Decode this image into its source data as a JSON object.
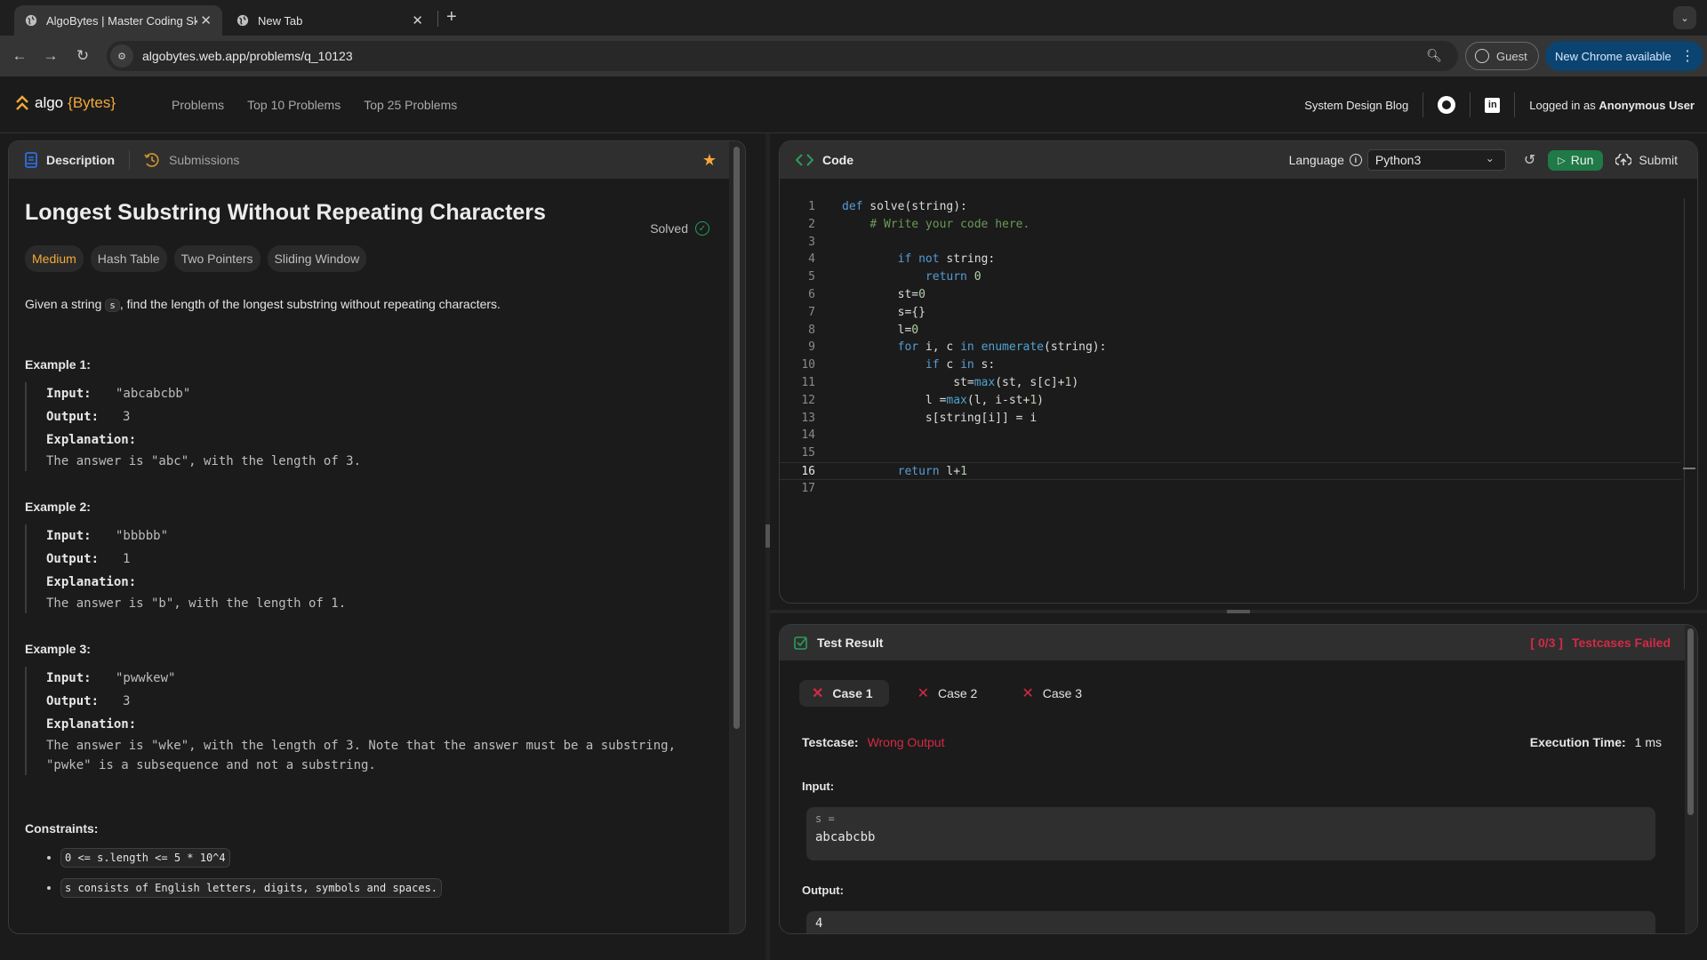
{
  "browser": {
    "tabs": [
      {
        "title": "AlgoBytes | Master Coding Sk",
        "active": true
      },
      {
        "title": "New Tab",
        "active": false
      }
    ],
    "url": "algobytes.web.app/problems/q_10123",
    "profile_label": "Guest",
    "update_label": "New Chrome available"
  },
  "app": {
    "logo_text": "algo",
    "logo_accent": "{Bytes}",
    "nav": [
      "Problems",
      "Top 10 Problems",
      "Top 25 Problems"
    ],
    "blog_link": "System Design Blog",
    "logged_in_prefix": "Logged in as ",
    "user_name": "Anonymous User",
    "accent_color": "#f2a93b"
  },
  "problem": {
    "tabs": {
      "description": "Description",
      "submissions": "Submissions"
    },
    "title": "Longest Substring Without Repeating Characters",
    "status": "Solved",
    "difficulty": "Medium",
    "topics": [
      "Hash Table",
      "Two Pointers",
      "Sliding Window"
    ],
    "statement_prefix": "Given a string ",
    "statement_var": "s",
    "statement_suffix": ", find the length of the longest substring without repeating characters.",
    "labels": {
      "input": "Input:",
      "output": "Output:",
      "explanation": "Explanation:"
    },
    "examples": [
      {
        "title": "Example 1:",
        "input": "\"abcabcbb\"",
        "output": "3",
        "explanation": "The answer is \"abc\", with the length of 3."
      },
      {
        "title": "Example 2:",
        "input": "\"bbbbb\"",
        "output": "1",
        "explanation": "The answer is \"b\", with the length of 1."
      },
      {
        "title": "Example 3:",
        "input": "\"pwwkew\"",
        "output": "3",
        "explanation": "The answer is \"wke\", with the length of 3. Note that the answer must be a substring, \"pwke\" is a subsequence and not a substring."
      }
    ],
    "constraints_title": "Constraints:",
    "constraints": [
      "0 <= s.length <= 5 * 10^4",
      "s consists of English letters, digits, symbols and spaces."
    ]
  },
  "editor": {
    "title": "Code",
    "language_label": "Language",
    "language": "Python3",
    "run_label": "Run",
    "submit_label": "Submit",
    "current_line": 16,
    "lines": [
      "def solve(string):",
      "    # Write your code here.",
      "",
      "        if not string:",
      "            return 0",
      "        st=0",
      "        s={}",
      "        l=0",
      "        for i, c in enumerate(string):",
      "            if c in s:",
      "                st=max(st, s[c]+1)",
      "            l =max(l, i-st+1)",
      "            s[string[i]] = i",
      "",
      "",
      "        return l+1",
      ""
    ]
  },
  "test_result": {
    "title": "Test Result",
    "summary_fraction": "[ 0/3 ]",
    "summary_text": "Testcases Failed",
    "cases": [
      "Case 1",
      "Case 2",
      "Case 3"
    ],
    "active_case": 0,
    "testcase_label": "Testcase:",
    "testcase_status": "Wrong Output",
    "exec_label": "Execution Time:",
    "exec_value": "1 ms",
    "input_label": "Input:",
    "input_var": "s =",
    "input_value": "abcabcbb",
    "output_label": "Output:",
    "output_value": "4",
    "fail_color": "#d22a44"
  }
}
